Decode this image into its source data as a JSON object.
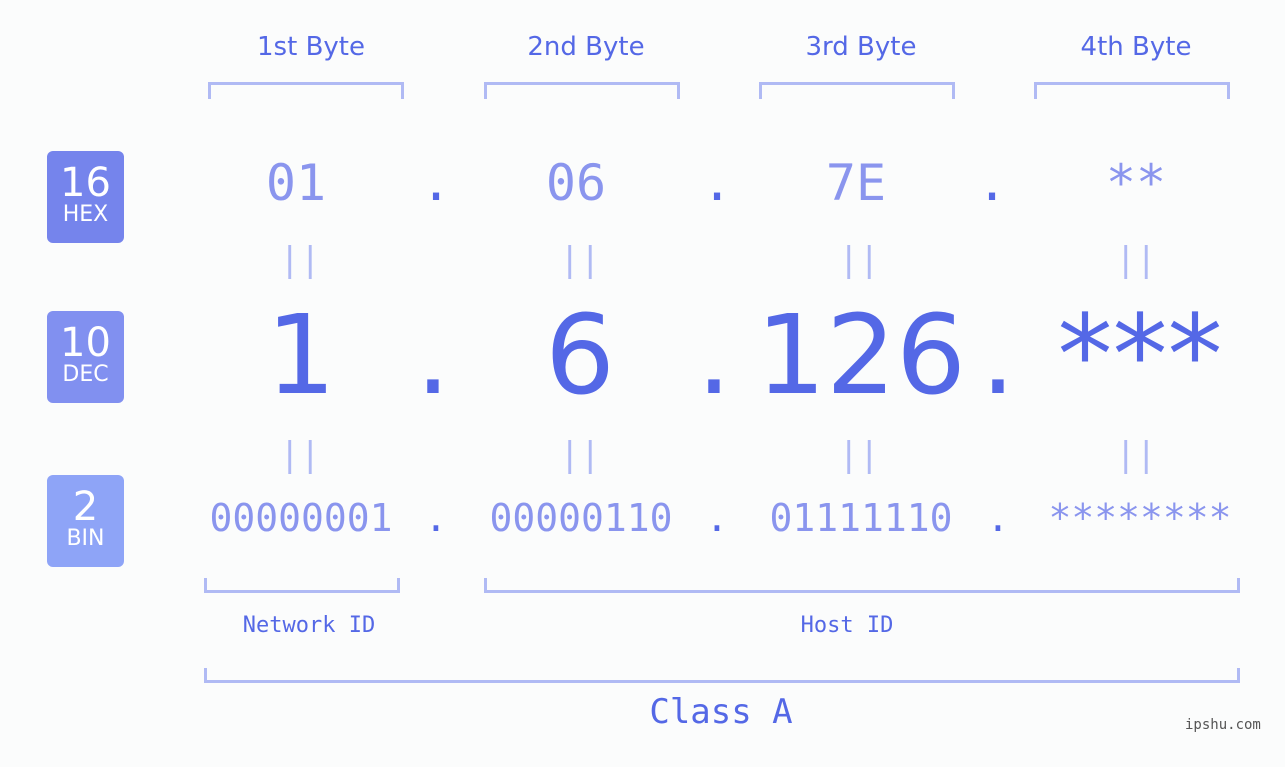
{
  "bytes": [
    {
      "header": "1st Byte",
      "hex": "01",
      "dec": "1",
      "bin": "00000001"
    },
    {
      "header": "2nd Byte",
      "hex": "06",
      "dec": "6",
      "bin": "00000110"
    },
    {
      "header": "3rd Byte",
      "hex": "7E",
      "dec": "126",
      "bin": "01111110"
    },
    {
      "header": "4th Byte",
      "hex": "**",
      "dec": "***",
      "bin": "********"
    }
  ],
  "separator": ".",
  "equals": "||",
  "badges": {
    "hex": {
      "num": "16",
      "label": "HEX",
      "color": "#7584ec"
    },
    "dec": {
      "num": "10",
      "label": "DEC",
      "color": "#8190f0"
    },
    "bin": {
      "num": "2",
      "label": "BIN",
      "color": "#8ea4f7"
    }
  },
  "network_id_label": "Network ID",
  "host_id_label": "Host ID",
  "class_label": "Class A",
  "watermark": "ipshu.com",
  "colors": {
    "accent": "#5468e6",
    "light": "#8a95ee",
    "bracket": "#b0baf4"
  }
}
